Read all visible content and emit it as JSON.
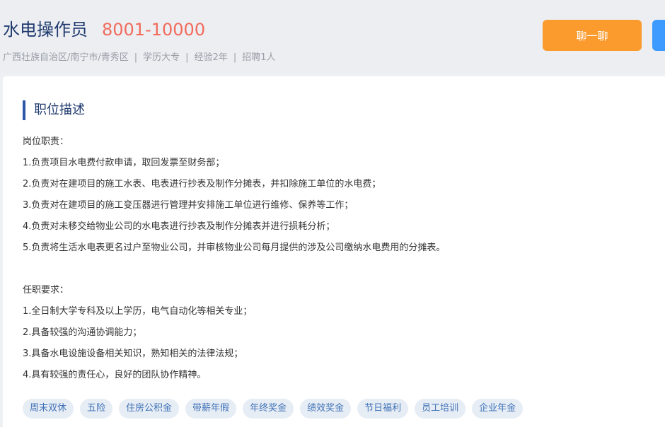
{
  "header": {
    "job_title": "水电操作员",
    "salary": "8001-10000",
    "meta": {
      "location": "广西壮族自治区/南宁市/青秀区",
      "education": "学历大专",
      "experience": "经验2年",
      "openings": "招聘1人",
      "separator": "|"
    },
    "chat_label": "聊一聊"
  },
  "section": {
    "title": "职位描述"
  },
  "description": {
    "duties_heading": "岗位职责：",
    "duties": [
      "1.负责项目水电费付款申请，取回发票至财务部；",
      "2.负责对在建项目的施工水表、电表进行抄表及制作分摊表，并扣除施工单位的水电费；",
      "3.负责对在建项目的施工变压器进行管理并安排施工单位进行维修、保养等工作；",
      "4.负责对未移交给物业公司的水电表进行抄表及制作分摊表并进行损耗分析；",
      "5.负责将生活水电表更名过户至物业公司，并审核物业公司每月提供的涉及公司缴纳水电费用的分摊表。"
    ],
    "requirements_heading": "任职要求：",
    "requirements": [
      "1.全日制大学专科及以上学历，电气自动化等相关专业；",
      "2.具备较强的沟通协调能力；",
      "3.具备水电设施设备相关知识，熟知相关的法律法规；",
      "4.具有较强的责任心，良好的团队协作精神。"
    ]
  },
  "benefits": [
    "周末双休",
    "五险",
    "住房公积金",
    "带薪年假",
    "年终奖金",
    "绩效奖金",
    "节日福利",
    "员工培训",
    "企业年金"
  ],
  "colors": {
    "title": "#1f3a6e",
    "salary": "#f26b5b",
    "chat_button": "#fb9b2e",
    "apply_button": "#3d9bff",
    "section_bar": "#2c57a8",
    "tag_bg": "#e7edf4",
    "tag_text": "#3f72b8"
  }
}
